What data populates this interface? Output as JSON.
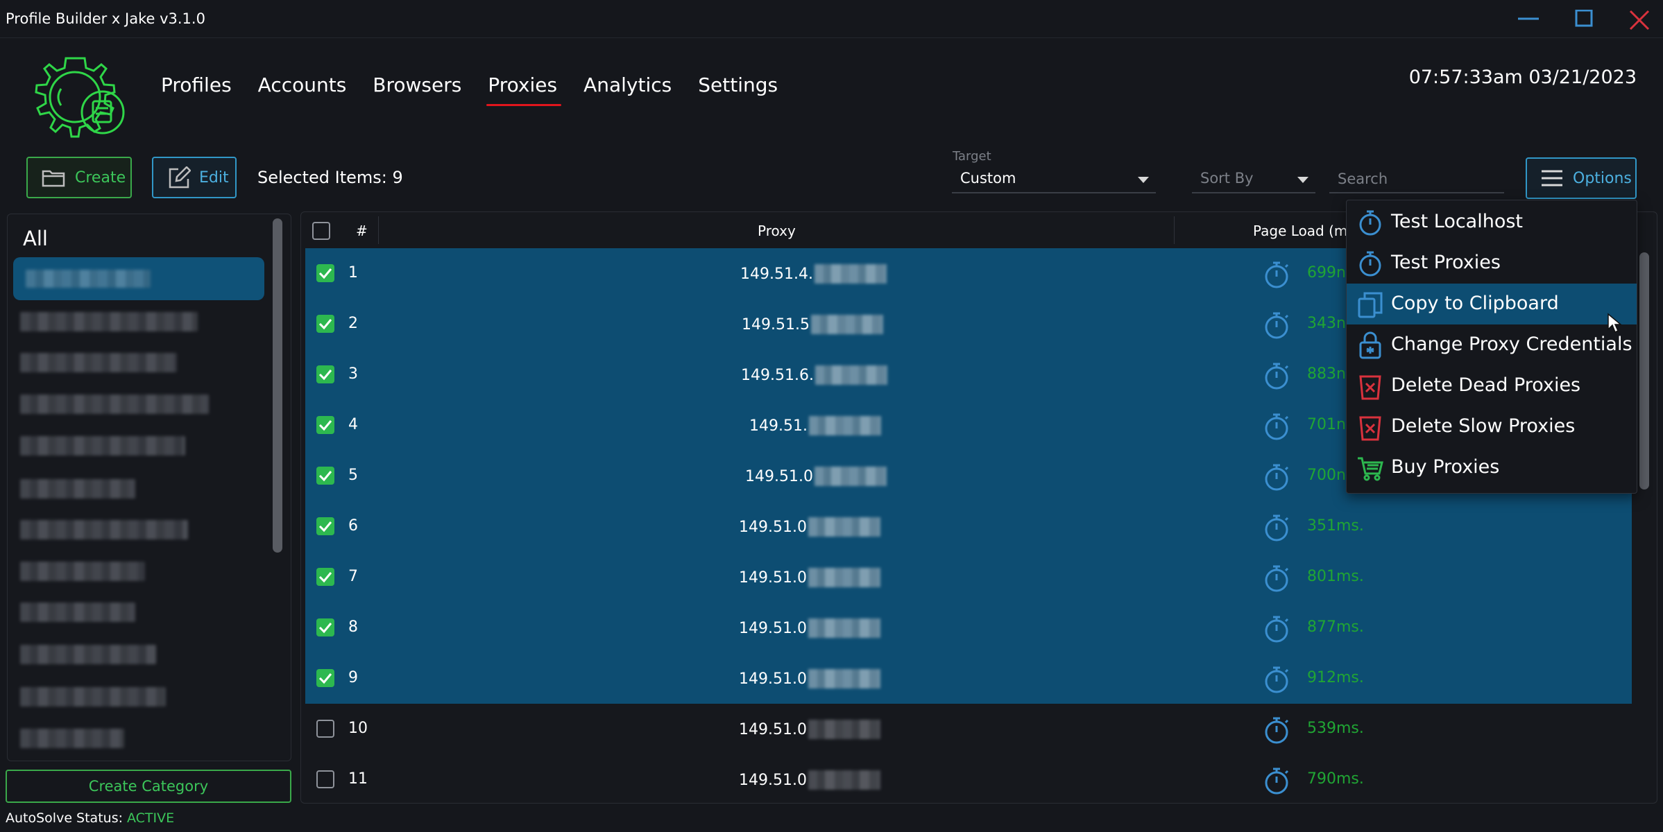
{
  "window": {
    "title": "Profile Builder x Jake v3.1.0"
  },
  "nav": [
    {
      "label": "Profiles",
      "active": false
    },
    {
      "label": "Accounts",
      "active": false
    },
    {
      "label": "Browsers",
      "active": false
    },
    {
      "label": "Proxies",
      "active": true
    },
    {
      "label": "Analytics",
      "active": false
    },
    {
      "label": "Settings",
      "active": false
    }
  ],
  "clock": "07:57:33am 03/21/2023",
  "toolbar": {
    "create_label": "Create",
    "edit_label": "Edit",
    "selected_items": "Selected Items: 9",
    "target_label": "Target",
    "target_value": "Custom",
    "sort_by_placeholder": "Sort By",
    "search_placeholder": "Search",
    "options_label": "Options"
  },
  "sidebar": {
    "all_label": "All",
    "create_category_label": "Create Category"
  },
  "status": {
    "label": "AutoSolve Status:",
    "value": "ACTIVE"
  },
  "table": {
    "headers": [
      "#",
      "Proxy",
      "Page Load (m"
    ],
    "rows": [
      {
        "num": "1",
        "proxy": "149.51.4.",
        "load": "699n",
        "checked": true
      },
      {
        "num": "2",
        "proxy": "149.51.5",
        "load": "343n",
        "checked": true
      },
      {
        "num": "3",
        "proxy": "149.51.6.",
        "load": "883n",
        "checked": true
      },
      {
        "num": "4",
        "proxy": "149.51.",
        "load": "701n",
        "checked": true
      },
      {
        "num": "5",
        "proxy": "149.51.0",
        "load": "700n",
        "checked": true
      },
      {
        "num": "6",
        "proxy": "149.51.0",
        "load": "351ms.",
        "checked": true
      },
      {
        "num": "7",
        "proxy": "149.51.0",
        "load": "801ms.",
        "checked": true
      },
      {
        "num": "8",
        "proxy": "149.51.0",
        "load": "877ms.",
        "checked": true
      },
      {
        "num": "9",
        "proxy": "149.51.0",
        "load": "912ms.",
        "checked": true
      },
      {
        "num": "10",
        "proxy": "149.51.0",
        "load": "539ms.",
        "checked": false
      },
      {
        "num": "11",
        "proxy": "149.51.0",
        "load": "790ms.",
        "checked": false
      }
    ]
  },
  "options_menu": [
    {
      "label": "Test Localhost",
      "icon": "stopwatch-icon",
      "color": "#3b8fd0"
    },
    {
      "label": "Test Proxies",
      "icon": "stopwatch-icon",
      "color": "#3b8fd0"
    },
    {
      "label": "Copy to Clipboard",
      "icon": "copy-icon",
      "color": "#3b8fd0",
      "hover": true
    },
    {
      "label": "Change Proxy Credentials",
      "icon": "lock-icon",
      "color": "#3b8fd0"
    },
    {
      "label": "Delete Dead Proxies",
      "icon": "trash-icon",
      "color": "#d9323d"
    },
    {
      "label": "Delete Slow Proxies",
      "icon": "trash-icon",
      "color": "#d9323d"
    },
    {
      "label": "Buy Proxies",
      "icon": "cart-icon",
      "color": "#2db84f"
    }
  ],
  "colors": {
    "accent_blue": "#3197c7",
    "accent_green": "#3aa94a",
    "selection": "#0d4d72",
    "nav_underline": "#e0151c",
    "load_text": "#20a534"
  }
}
